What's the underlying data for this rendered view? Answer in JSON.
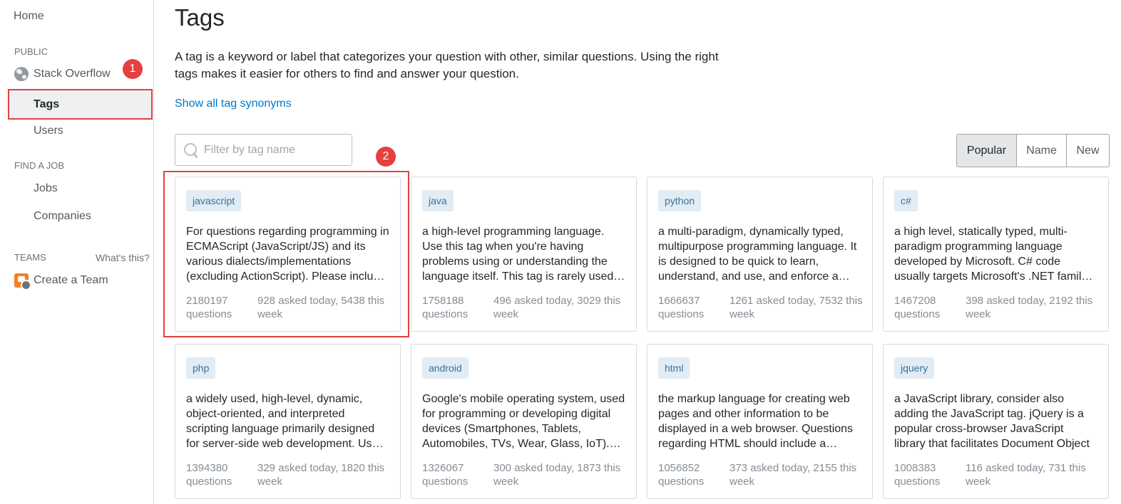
{
  "sidebar": {
    "home": "Home",
    "public_heading": "PUBLIC",
    "stack_overflow": "Stack Overflow",
    "tags": "Tags",
    "users": "Users",
    "find_job_heading": "FIND A JOB",
    "jobs": "Jobs",
    "companies": "Companies",
    "teams_heading": "TEAMS",
    "whats_this": "What's this?",
    "create_team": "Create a Team"
  },
  "badges": {
    "one": "1",
    "two": "2"
  },
  "main": {
    "title": "Tags",
    "description": "A tag is a keyword or label that categorizes your question with other, similar questions. Using the right tags makes it easier for others to find and answer your question.",
    "synonyms_link": "Show all tag synonyms",
    "filter_placeholder": "Filter by tag name",
    "sort": {
      "popular": "Popular",
      "name": "Name",
      "new": "New",
      "selected": "Popular"
    }
  },
  "tags": [
    {
      "name": "javascript",
      "description": "For questions regarding programming in ECMAScript (JavaScript/JS) and its various dialects/implementations (excluding ActionScript). Please include all relevant tags on your question;",
      "count": "2180197",
      "count_label": "questions",
      "activity": "928 asked today, 5438 this week"
    },
    {
      "name": "java",
      "description": "a high-level programming language. Use this tag when you're having problems using or understanding the language itself. This tag is rarely used alone",
      "count": "1758188",
      "count_label": "questions",
      "activity": "496 asked today, 3029 this week"
    },
    {
      "name": "python",
      "description": "a multi-paradigm, dynamically typed, multipurpose programming language. It is designed to be quick to learn, understand, and use, and enforce a clean syntax",
      "count": "1666637",
      "count_label": "questions",
      "activity": "1261 asked today, 7532 this week"
    },
    {
      "name": "c#",
      "description": "a high level, statically typed, multi-paradigm programming language developed by Microsoft. C# code usually targets Microsoft's .NET family of tools",
      "count": "1467208",
      "count_label": "questions",
      "activity": "398 asked today, 2192 this week"
    },
    {
      "name": "php",
      "description": "a widely used, high-level, dynamic, object-oriented, and interpreted scripting language primarily designed for server-side web development. Used for",
      "count": "1394380",
      "count_label": "questions",
      "activity": "329 asked today, 1820 this week"
    },
    {
      "name": "android",
      "description": "Google's mobile operating system, used for programming or developing digital devices (Smartphones, Tablets, Automobiles, TVs, Wear, Glass, IoT). For",
      "count": "1326067",
      "count_label": "questions",
      "activity": "300 asked today, 1873 this week"
    },
    {
      "name": "html",
      "description": "the markup language for creating web pages and other information to be displayed in a web browser. Questions regarding HTML should include a minimal",
      "count": "1056852",
      "count_label": "questions",
      "activity": "373 asked today, 2155 this week"
    },
    {
      "name": "jquery",
      "description": "a JavaScript library, consider also adding the JavaScript tag. jQuery is a popular cross-browser JavaScript library that facilitates Document Object",
      "count": "1008383",
      "count_label": "questions",
      "activity": "116 asked today, 731 this week"
    }
  ]
}
